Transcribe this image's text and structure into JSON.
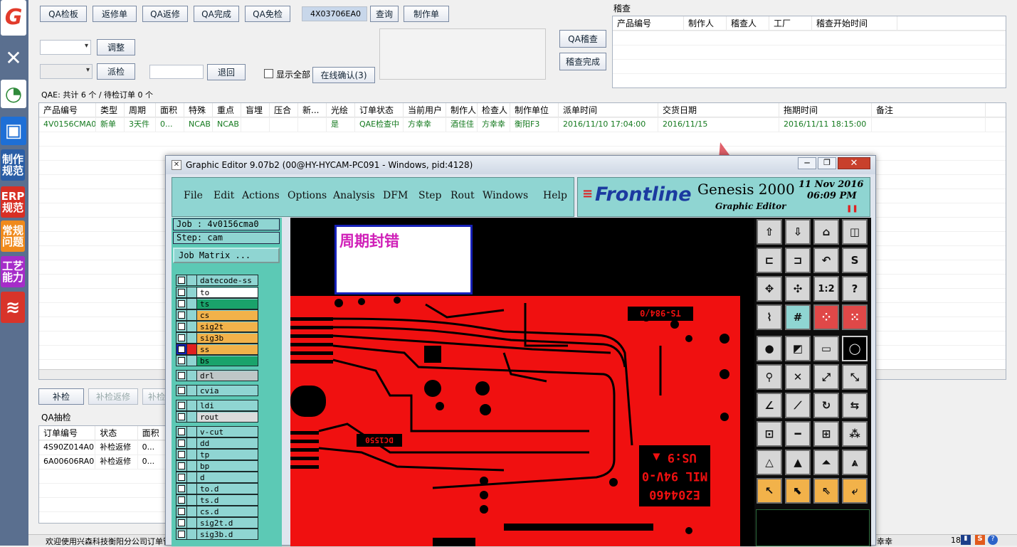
{
  "rail": {
    "items": [
      {
        "label": "G",
        "color": "#e23b2b"
      },
      {
        "label": "✕",
        "color": "#5a6f8f"
      },
      {
        "label": "◔",
        "color": "#2f8a3a"
      },
      {
        "label": "▣",
        "color": "#1e6fd6"
      },
      {
        "label": "制作规范",
        "color": "#2a5ea6"
      },
      {
        "label": "ERP规范",
        "color": "#d82f24"
      },
      {
        "label": "常规问题",
        "color": "#f08a1c"
      },
      {
        "label": "工艺能力",
        "color": "#a62cc9"
      },
      {
        "label": "≋",
        "color": "#d8342a"
      }
    ]
  },
  "toolbar": {
    "qa_board": "QA检板",
    "rework_order": "返修单",
    "qa_rework": "QA返修",
    "qa_done": "QA完成",
    "qa_exempt": "QA免检",
    "search_value": "4X03706EA0",
    "query": "查询",
    "make_order": "制作单",
    "adjust": "调整",
    "dispatch": "派检",
    "return_inspect": "退回",
    "show_all": "显示全部",
    "online_confirm": "在线确认(3)",
    "qa_audit": "QA稽查",
    "audit_done": "稽查完成"
  },
  "audit": {
    "group_title": "稽查",
    "columns": [
      "产品编号",
      "制作人",
      "稽查人",
      "工厂",
      "稽查开始时间"
    ]
  },
  "qae_summary": "QAE: 共计 6 个 / 待检订单 0 个",
  "main_table": {
    "columns": [
      "产品编号",
      "类型",
      "周期",
      "面积",
      "特殊",
      "重点",
      "盲埋",
      "压合",
      "新...",
      "光绘",
      "订单状态",
      "当前用户",
      "制作人",
      "检查人",
      "制作单位",
      "派单时间",
      "交货日期",
      "拖期时间",
      "备注"
    ],
    "rows": [
      [
        "4V0156CMA0",
        "新单",
        "3天件",
        "0...",
        "NCAB",
        "NCAB",
        "",
        "",
        "",
        "是",
        "QAE检查中",
        "方幸幸",
        "酒佳佳",
        "方幸幸",
        "衡阳F3",
        "2016/11/10 17:04:00",
        "2016/11/15",
        "2016/11/11 18:15:00",
        ""
      ]
    ]
  },
  "lower_buttons": {
    "reinspect": "补检",
    "reinspect_rework": "补检返修",
    "reinspect3": "补检"
  },
  "qa_sample": {
    "group_title": "QA抽检",
    "columns": [
      "订单编号",
      "状态",
      "面积"
    ],
    "rows": [
      [
        "4S90Z014A0",
        "补检返修",
        "0..."
      ],
      [
        "6A00606RA0",
        "补检返修",
        "0..."
      ]
    ]
  },
  "status_bar": {
    "left": "欢迎使用兴森科技衡阳分公司订单管理系统",
    "right_name": "幸幸",
    "right_num": "18"
  },
  "ge": {
    "title": "Graphic Editor 9.07b2 (00@HY-HYCAM-PC091 - Windows, pid:4128)",
    "menu": [
      "File",
      "Edit",
      "Actions",
      "Options",
      "Analysis",
      "DFM",
      "Step",
      "Rout",
      "Windows",
      "Help"
    ],
    "brand": "Frontline",
    "product": "Genesis 2000",
    "subtitle": "Graphic Editor",
    "date": "11 Nov 2016",
    "time": "06:09 PM",
    "job": "Job : 4v0156cma0",
    "step": "Step: cam",
    "job_matrix": "Job Matrix ...",
    "layers": [
      {
        "name": "datecode-ss",
        "color": "#8fd5d2"
      },
      {
        "name": "to",
        "color": "#ffffff"
      },
      {
        "name": "ts",
        "color": "#1aa36b"
      },
      {
        "name": "cs",
        "color": "#f2b24a"
      },
      {
        "name": "sig2t",
        "color": "#f2b24a"
      },
      {
        "name": "sig3b",
        "color": "#f2b24a"
      },
      {
        "name": "ss",
        "color": "#f2b24a"
      },
      {
        "name": "bs",
        "color": "#1aa36b"
      },
      {
        "name": "drl",
        "color": "#bfc7c7"
      },
      {
        "name": "cvia",
        "color": "#8fd5d2"
      },
      {
        "name": "ldi",
        "color": "#8fd5d2"
      },
      {
        "name": "rout",
        "color": "#dcdcdc"
      },
      {
        "name": "v-cut",
        "color": "#8fd5d2"
      },
      {
        "name": "dd",
        "color": "#8fd5d2"
      },
      {
        "name": "tp",
        "color": "#8fd5d2"
      },
      {
        "name": "bp",
        "color": "#8fd5d2"
      },
      {
        "name": "d",
        "color": "#8fd5d2"
      },
      {
        "name": "to.d",
        "color": "#8fd5d2"
      },
      {
        "name": "ts.d",
        "color": "#8fd5d2"
      },
      {
        "name": "cs.d",
        "color": "#8fd5d2"
      },
      {
        "name": "sig2t.d",
        "color": "#8fd5d2"
      },
      {
        "name": "sig3b.d",
        "color": "#8fd5d2"
      }
    ],
    "annotation": "周期封错",
    "board_text_top": "TS-984/0",
    "board_text_mid": "DC1550",
    "board_text_r1": "E204460",
    "board_text_r2": "MIL 94V-0",
    "board_text_r3": "US:9 ▲"
  }
}
